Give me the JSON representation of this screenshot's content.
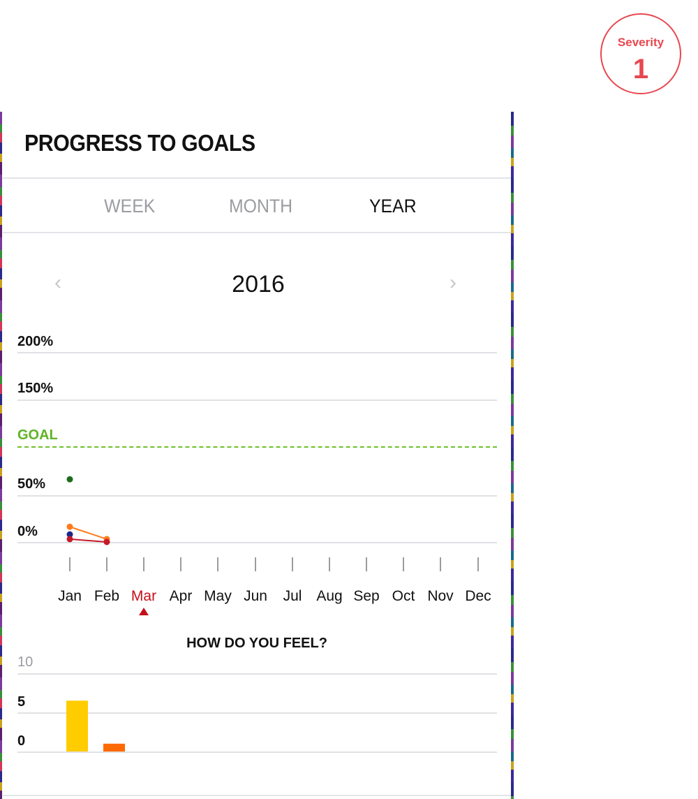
{
  "badge": {
    "label": "Severity",
    "value": "1",
    "color": "#e8474f"
  },
  "header": {
    "title": "PROGRESS TO GOALS"
  },
  "tabs": [
    {
      "label": "WEEK",
      "active": false
    },
    {
      "label": "MONTH",
      "active": false
    },
    {
      "label": "YEAR",
      "active": true
    }
  ],
  "year_nav": {
    "year": "2016",
    "prev_icon": "chevron-left-icon",
    "next_icon": "chevron-right-icon"
  },
  "progress_chart": {
    "y_labels": [
      "200%",
      "150%",
      "GOAL",
      "50%",
      "0%"
    ],
    "goal_color": "#6cc02c",
    "months": [
      "Jan",
      "Feb",
      "Mar",
      "Apr",
      "May",
      "Jun",
      "Jul",
      "Aug",
      "Sep",
      "Oct",
      "Nov",
      "Dec"
    ],
    "current_month": "Mar"
  },
  "feel_chart": {
    "title": "HOW DO YOU FEEL?",
    "y_labels": [
      "10",
      "5",
      "0"
    ]
  },
  "chart_data": [
    {
      "type": "line",
      "title": "",
      "categories": [
        "Jan",
        "Feb",
        "Mar",
        "Apr",
        "May",
        "Jun",
        "Jul",
        "Aug",
        "Sep",
        "Oct",
        "Nov",
        "Dec"
      ],
      "ylim": [
        0,
        200
      ],
      "goal": 100,
      "series": [
        {
          "color": "#1e6b1e",
          "values": [
            66,
            null,
            null,
            null,
            null,
            null,
            null,
            null,
            null,
            null,
            null,
            null
          ]
        },
        {
          "color": "#ff7a1a",
          "values": [
            16,
            3,
            null,
            null,
            null,
            null,
            null,
            null,
            null,
            null,
            null,
            null
          ]
        },
        {
          "color": "#1a2a8a",
          "values": [
            8,
            null,
            null,
            null,
            null,
            null,
            null,
            null,
            null,
            null,
            null,
            null
          ]
        },
        {
          "color": "#c41a2a",
          "values": [
            3,
            0,
            null,
            null,
            null,
            null,
            null,
            null,
            null,
            null,
            null,
            null
          ]
        }
      ]
    },
    {
      "type": "bar",
      "title": "HOW DO YOU FEEL?",
      "categories": [
        "Jan",
        "Feb",
        "Mar",
        "Apr",
        "May",
        "Jun",
        "Jul",
        "Aug",
        "Sep",
        "Oct",
        "Nov",
        "Dec"
      ],
      "ylim": [
        0,
        10
      ],
      "values": [
        6.5,
        1,
        null,
        null,
        null,
        null,
        null,
        null,
        null,
        null,
        null,
        null
      ],
      "colors": [
        "#ffcc00",
        "#ff6a00"
      ]
    }
  ]
}
